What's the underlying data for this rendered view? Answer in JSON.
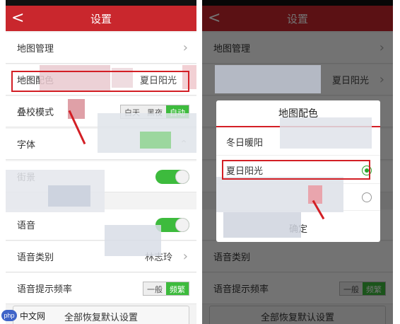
{
  "header": {
    "title": "设置",
    "back_glyph": "<"
  },
  "settings": {
    "map_manage": "地图管理",
    "map_color": "地图配色",
    "map_color_value": "夏日阳光",
    "overlay_mode": "叠校模式",
    "overlay_options": [
      "白天",
      "黑夜",
      "自动"
    ],
    "font": "字体",
    "street": "街景",
    "voice": "语音",
    "voice_type": "语音类别",
    "voice_type_value": "林志玲",
    "voice_freq": "语音提示频率",
    "voice_freq_options": [
      "一般",
      "频繁"
    ],
    "reset": "全部恢复默认设置"
  },
  "dialog": {
    "title": "地图配色",
    "options": [
      "冬日暖阳",
      "夏日阳光",
      ""
    ],
    "selected_index": 1,
    "confirm": "确定"
  },
  "watermark": {
    "logo": "php",
    "text": "中文网"
  },
  "colors": {
    "header": "#c9272d",
    "accent_green": "#3dbb3d",
    "annotation": "#d31f25"
  }
}
